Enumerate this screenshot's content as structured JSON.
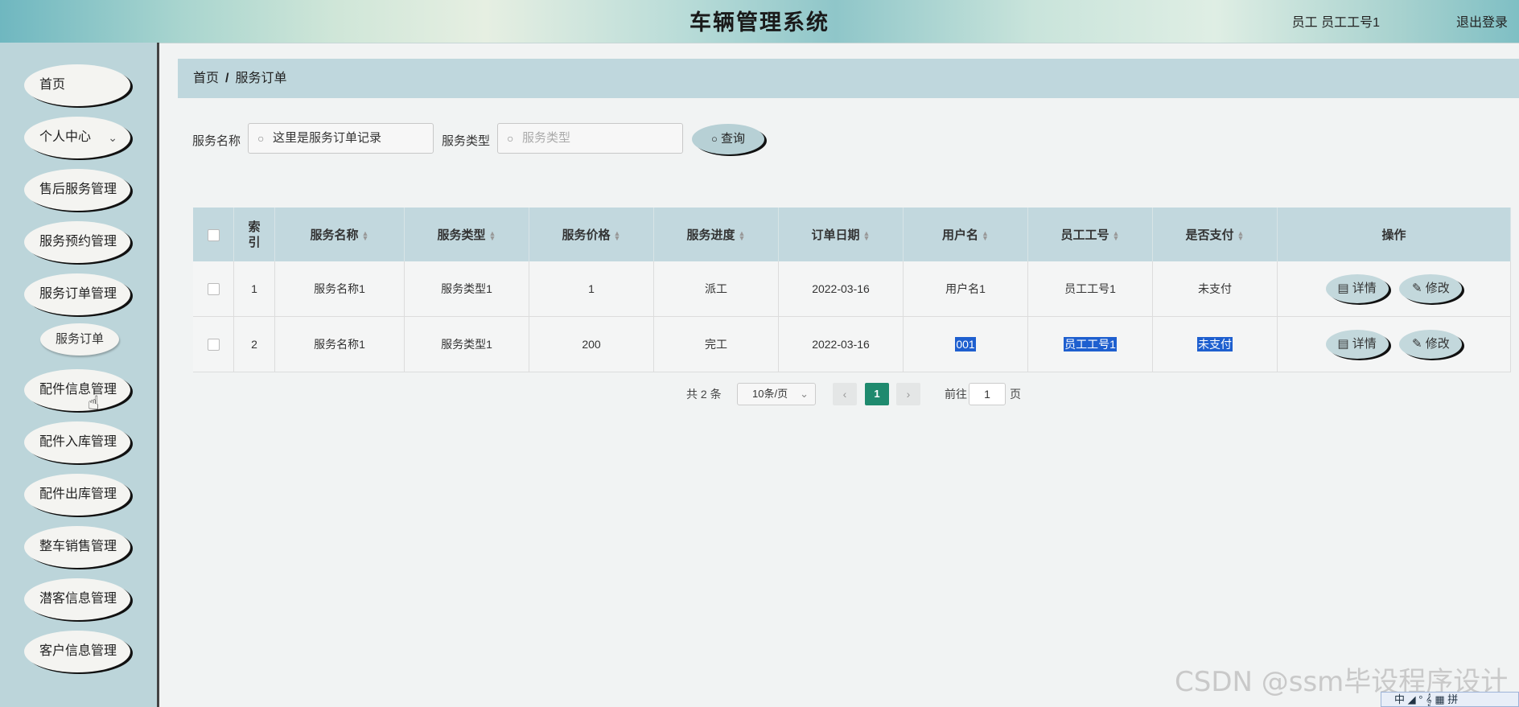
{
  "header": {
    "title": "车辆管理系统",
    "user": "员工  员工工号1",
    "logout": "退出登录"
  },
  "sidebar": {
    "items": [
      {
        "label": "首页"
      },
      {
        "label": "个人中心",
        "icon": "chevron-down"
      },
      {
        "label": "售后服务管理"
      },
      {
        "label": "服务预约管理"
      },
      {
        "label": "服务订单管理"
      },
      {
        "label": "配件信息管理"
      },
      {
        "label": "配件入库管理"
      },
      {
        "label": "配件出库管理"
      },
      {
        "label": "整车销售管理"
      },
      {
        "label": "潜客信息管理"
      },
      {
        "label": "客户信息管理"
      }
    ],
    "sub_item": "服务订单"
  },
  "breadcrumb": {
    "home": "首页",
    "sep": "/",
    "current": "服务订单"
  },
  "search": {
    "name_label": "服务名称",
    "name_value": "这里是服务订单记录",
    "type_label": "服务类型",
    "type_placeholder": "服务类型",
    "query_button": "查询"
  },
  "table": {
    "columns": [
      "索引",
      "服务名称",
      "服务类型",
      "服务价格",
      "服务进度",
      "订单日期",
      "用户名",
      "员工工号",
      "是否支付",
      "操作"
    ],
    "rows": [
      {
        "index": "1",
        "name": "服务名称1",
        "type": "服务类型1",
        "price": "1",
        "progress": "派工",
        "date": "2022-03-16",
        "username": "用户名1",
        "staff_no": "员工工号1",
        "paid": "未支付"
      },
      {
        "index": "2",
        "name": "服务名称1",
        "type": "服务类型1",
        "price": "200",
        "progress": "完工",
        "date": "2022-03-16",
        "username": "001",
        "staff_no": "员工工号1",
        "paid": "未支付"
      }
    ],
    "detail_button": "详情",
    "edit_button": "修改"
  },
  "pagination": {
    "total_prefix": "共",
    "total": "2",
    "total_suffix": "条",
    "page_size": "10条/页",
    "current_page": "1",
    "goto_label": "前往",
    "goto_value": "1",
    "page_suffix": "页"
  },
  "watermark": "CSDN @ssm毕设程序设计",
  "ime": "中 ◢ ° 𝄞 ▦ 拼"
}
